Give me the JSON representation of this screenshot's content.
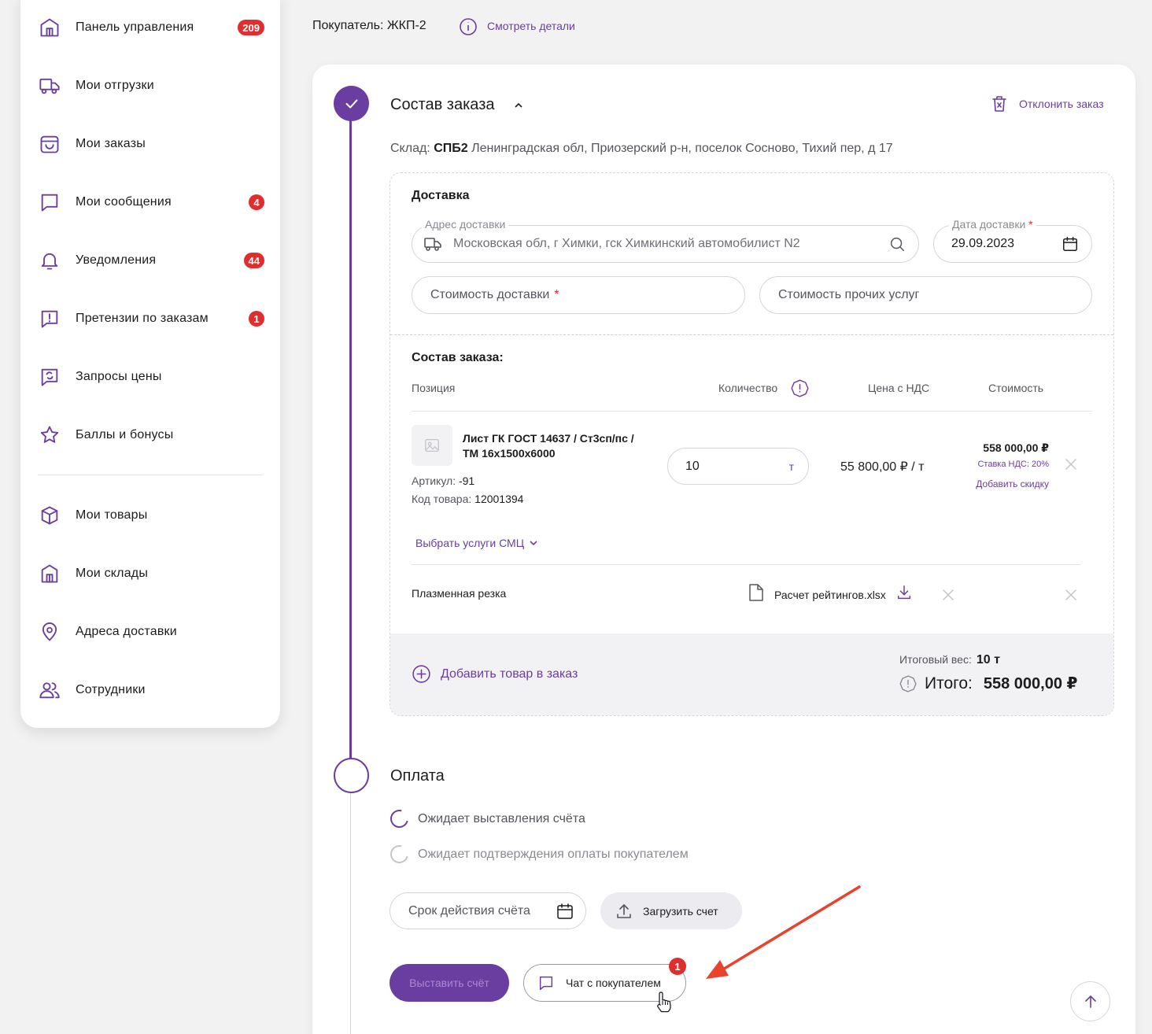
{
  "sidebar": {
    "items": [
      {
        "label": "Панель управления",
        "badge": "209",
        "icon": "building-icon"
      },
      {
        "label": "Мои отгрузки",
        "badge": "",
        "icon": "truck-icon"
      },
      {
        "label": "Мои заказы",
        "badge": "",
        "icon": "basket-icon"
      },
      {
        "label": "Мои сообщения",
        "badge": "4",
        "icon": "message-icon"
      },
      {
        "label": "Уведомления",
        "badge": "44",
        "icon": "bell-icon"
      },
      {
        "label": "Претензии по заказам",
        "badge": "1",
        "icon": "claim-icon"
      },
      {
        "label": "Запросы цены",
        "badge": "",
        "icon": "price-request-icon"
      },
      {
        "label": "Баллы и бонусы",
        "badge": "",
        "icon": "star-icon"
      },
      {
        "label": "Мои товары",
        "badge": "",
        "icon": "box-icon"
      },
      {
        "label": "Мои склады",
        "badge": "",
        "icon": "warehouse-icon"
      },
      {
        "label": "Адреса доставки",
        "badge": "",
        "icon": "location-icon"
      },
      {
        "label": "Сотрудники",
        "badge": "",
        "icon": "users-icon"
      }
    ]
  },
  "header": {
    "buyer": "Покупатель: ЖКП-2",
    "details_link": "Смотреть детали"
  },
  "order": {
    "title": "Состав заказа",
    "reject": "Отклонить заказ",
    "warehouse_label": "Склад:",
    "warehouse_code": "СПБ2",
    "warehouse_address": "Ленинградская обл, Приозерский р-н, поселок Сосново, Тихий пер, д 17",
    "delivery": {
      "title": "Доставка",
      "address_legend": "Адрес доставки",
      "address_value": "Московская обл, г Химки, гск Химкинский автомобилист N2",
      "date_legend": "Дата доставки",
      "date_value": "29.09.2023",
      "cost_placeholder": "Стоимость доставки",
      "other_placeholder": "Стоимость прочих услуг",
      "required_mark": "*"
    },
    "items_title": "Состав заказа:",
    "columns": {
      "position": "Позиция",
      "quantity": "Количество",
      "price": "Цена с НДС",
      "cost": "Стоимость"
    },
    "item": {
      "name": "Лист ГК ГОСТ 14637 / Ст3сп/пс / ТМ 16х1500х6000",
      "article_label": "Артикул:",
      "article": "-91",
      "code_label": "Код товара:",
      "code": "12001394",
      "quantity": "10",
      "unit": "т",
      "price": "55 800,00 ₽ / т",
      "cost": "558 000,00 ₽",
      "vat": "Ставка НДС: 20%",
      "add_discount": "Добавить скидку"
    },
    "smc_services": "Выбрать услуги СМЦ",
    "service": {
      "name": "Плазменная резка",
      "file": "Расчет рейтингов.xlsx"
    },
    "add_item": "Добавить товар в заказ",
    "total_weight_label": "Итоговый вес:",
    "total_weight": "10 т",
    "total_label": "Итого:",
    "total_value": "558 000,00 ₽"
  },
  "payment": {
    "title": "Оплата",
    "status1": "Ожидает выставления счёта",
    "status2": "Ожидает подтверждения оплаты покупателем",
    "invoice_validity": "Срок действия счёта",
    "upload_invoice": "Загрузить счет",
    "issue_invoice": "Выставить счёт",
    "chat": "Чат с покупателем",
    "chat_badge": "1"
  },
  "colors": {
    "accent": "#6a3da0",
    "badge": "#e02d2d",
    "arrow": "#e8432d"
  }
}
